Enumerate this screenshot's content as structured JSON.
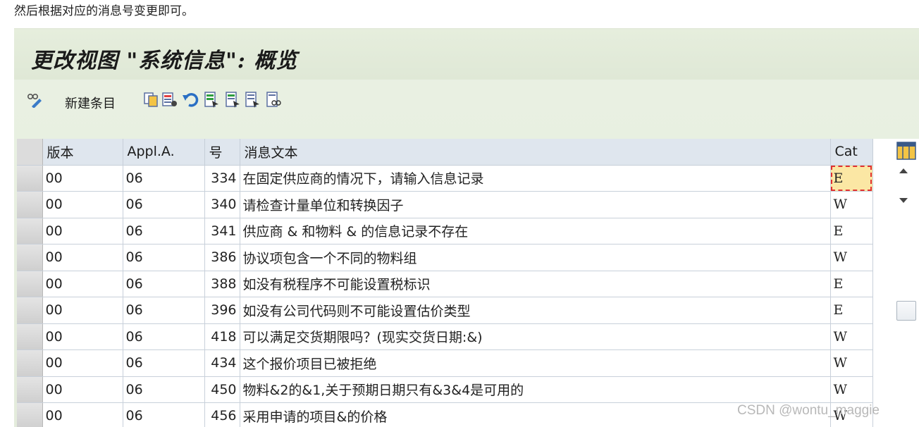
{
  "caption": "然后根据对应的消息号变更即可。",
  "window": {
    "title": "更改视图 \"系统信息\": 概览"
  },
  "toolbar": {
    "new_entry_label": "新建条目",
    "icons": [
      "change-display-icon",
      "copy-icon",
      "delete-icon",
      "undo-icon",
      "select-all-icon",
      "select-block-icon",
      "deselect-all-icon",
      "print-icon"
    ]
  },
  "table": {
    "columns": [
      "版本",
      "Appl.A.",
      "号",
      "消息文本",
      "Cat"
    ],
    "rows": [
      {
        "version": "00",
        "appl": "06",
        "num": "334",
        "text": "在固定供应商的情况下，请输入信息记录",
        "cat": "E"
      },
      {
        "version": "00",
        "appl": "06",
        "num": "340",
        "text": "请检查计量单位和转换因子",
        "cat": "W"
      },
      {
        "version": "00",
        "appl": "06",
        "num": "341",
        "text": "供应商 & 和物料 & 的信息记录不存在",
        "cat": "E"
      },
      {
        "version": "00",
        "appl": "06",
        "num": "386",
        "text": "协议项包含一个不同的物料组",
        "cat": "W"
      },
      {
        "version": "00",
        "appl": "06",
        "num": "388",
        "text": "如没有税程序不可能设置税标识",
        "cat": "E"
      },
      {
        "version": "00",
        "appl": "06",
        "num": "396",
        "text": "如没有公司代码则不可能设置估价类型",
        "cat": "E"
      },
      {
        "version": "00",
        "appl": "06",
        "num": "418",
        "text": "可以满足交货期限吗？(现实交货日期:&)",
        "cat": "W"
      },
      {
        "version": "00",
        "appl": "06",
        "num": "434",
        "text": "这个报价项目已被拒绝",
        "cat": "W"
      },
      {
        "version": "00",
        "appl": "06",
        "num": "450",
        "text": "物料&2的&1,关于预期日期只有&3&4是可用的",
        "cat": "W"
      },
      {
        "version": "00",
        "appl": "06",
        "num": "456",
        "text": "采用申请的项目&的价格",
        "cat": "W"
      }
    ]
  },
  "watermark": "CSDN @wontu_maggie"
}
